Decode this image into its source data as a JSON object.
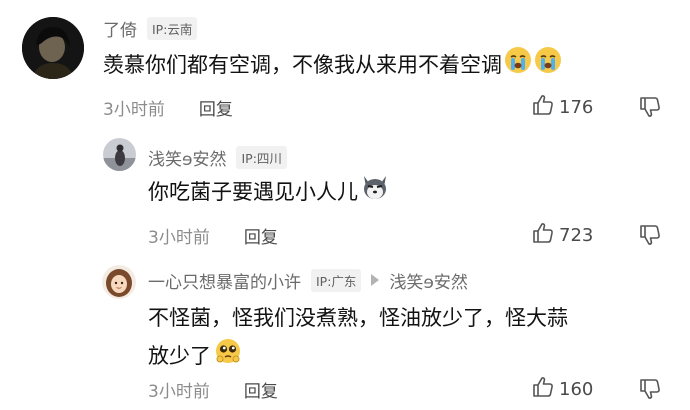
{
  "comments": [
    {
      "username": "了倚",
      "ip": "IP:云南",
      "text": "羡慕你们都有空调，不像我从来用不着空调",
      "emojis": [
        "crying-face",
        "crying-face"
      ],
      "time": "3小时前",
      "reply_label": "回复",
      "likes": "176"
    },
    {
      "username": "浅笑ɘ安然",
      "ip": "IP:四川",
      "text": "你吃菌子要遇见小人儿",
      "emojis": [
        "husky-dog"
      ],
      "time": "3小时前",
      "reply_label": "回复",
      "likes": "723"
    },
    {
      "username": "一心只想暴富的小许",
      "ip": "IP:广东",
      "reply_to": "浅笑ɘ安然",
      "text_line1": "不怪菌，怪我们没煮熟，怪油放少了，怪大蒜",
      "text_line2": "放少了",
      "emojis": [
        "pleading-face"
      ],
      "time": "3小时前",
      "reply_label": "回复",
      "likes": "160"
    }
  ],
  "colors": {
    "username": "#6b6b6b",
    "text": "#121212",
    "meta": "#8c8c8c",
    "ip_badge_bg": "#f1f1f1"
  }
}
